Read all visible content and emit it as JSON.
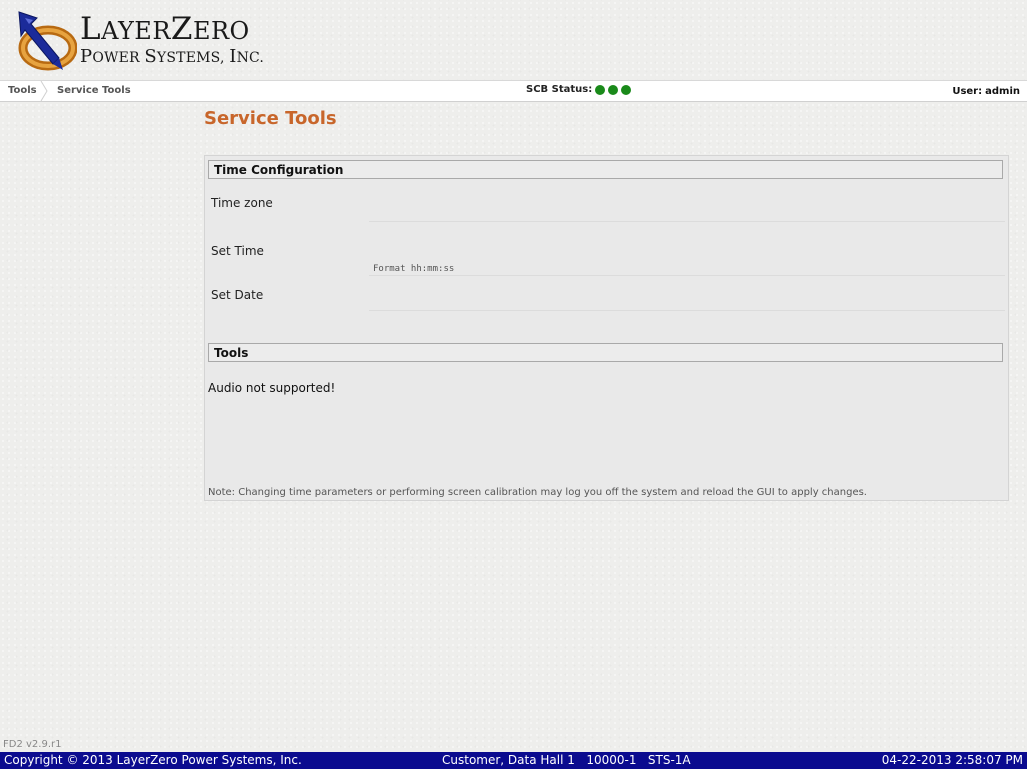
{
  "brand": {
    "name_initial": "L",
    "name_rest_1": "AYER",
    "name_initial_2": "Z",
    "name_rest_2": "ERO",
    "tagline_initial": "P",
    "tagline_rest_1": "OWER ",
    "tagline_initial_2": "S",
    "tagline_rest_2": "YSTEMS, ",
    "tagline_initial_3": "I",
    "tagline_rest_3": "NC."
  },
  "navbar": {
    "breadcrumbs": [
      "Tools",
      "Service Tools"
    ],
    "scb_status_label": "SCB Status:",
    "scb_status_colors": [
      "#1a8a1a",
      "#1a8a1a",
      "#1a8a1a"
    ],
    "user_label": "User:",
    "user_name": "admin"
  },
  "page": {
    "title": "Service Tools"
  },
  "time_config": {
    "header": "Time Configuration",
    "time_zone_label": "Time zone",
    "time_zone_value": "",
    "set_time_label": "Set Time",
    "set_time_value": "",
    "set_time_hint": "Format hh:mm:ss",
    "set_date_label": "Set Date",
    "set_date_value": ""
  },
  "tools": {
    "header": "Tools",
    "audio_message": "Audio not supported!",
    "note": "Note: Changing time parameters or performing screen calibration may log you off the system and reload the GUI to apply changes."
  },
  "footer": {
    "version": "FD2 v2.9.r1",
    "copyright": "Copyright © 2013 LayerZero Power Systems, Inc.",
    "site": "Customer, Data Hall 1   10000-1   STS-1A",
    "datetime": "04-22-2013 2:58:07 PM"
  },
  "colors": {
    "accent_title": "#c8662b",
    "footer_bg": "#0b0b8f",
    "status_ok": "#1a8a1a"
  }
}
